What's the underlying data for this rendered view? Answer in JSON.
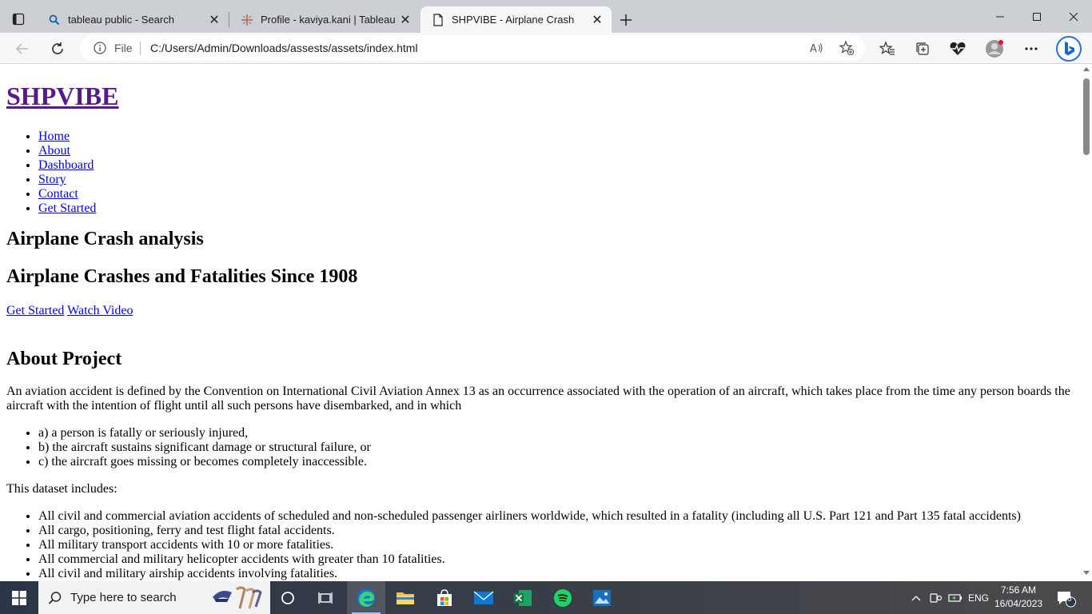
{
  "browser": {
    "tabs": [
      {
        "title": "tableau public - Search",
        "icon": "search-icon"
      },
      {
        "title": "Profile - kaviya.kani | Tableau Pub",
        "icon": "tableau-icon"
      },
      {
        "title": "SHPVIBE - Airplane Crash",
        "icon": "page-icon",
        "active": true
      }
    ],
    "address": {
      "scheme_label": "File",
      "url": "C:/Users/Admin/Downloads/assests/assets/index.html"
    }
  },
  "page": {
    "brand": "SHPVIBE",
    "nav": [
      "Home",
      "About",
      "Dashboard",
      "Story",
      "Contact",
      "Get Started"
    ],
    "hero_title": "Airplane Crash analysis",
    "hero_subtitle": "Airplane Crashes and Fatalities Since 1908",
    "cta_primary": "Get Started",
    "cta_secondary": "Watch Video",
    "about_heading": "About Project",
    "about_paragraph": "An aviation accident is defined by the Convention on International Civil Aviation Annex 13 as an occurrence associated with the operation of an aircraft, which takes place from the time any person boards the aircraft with the intention of flight until all such persons have disembarked, and in which",
    "criteria": [
      "a) a person is fatally or seriously injured,",
      "b) the aircraft sustains significant damage or structural failure, or",
      "c) the aircraft goes missing or becomes completely inaccessible."
    ],
    "dataset_intro": "This dataset includes:",
    "dataset_items": [
      "All civil and commercial aviation accidents of scheduled and non-scheduled passenger airliners worldwide, which resulted in a fatality (including all U.S. Part 121 and Part 135 fatal accidents)",
      "All cargo, positioning, ferry and test flight fatal accidents.",
      "All military transport accidents with 10 or more fatalities.",
      "All commercial and military helicopter accidents with greater than 10 fatalities.",
      "All civil and military airship accidents involving fatalities."
    ]
  },
  "taskbar": {
    "search_placeholder": "Type here to search",
    "language": "ENG",
    "time": "7:56 AM",
    "date": "16/04/2023",
    "notification_count": "6"
  },
  "colors": {
    "visited_link": "#551a8b",
    "link": "#0000ee",
    "taskbar": "#2a3547"
  }
}
